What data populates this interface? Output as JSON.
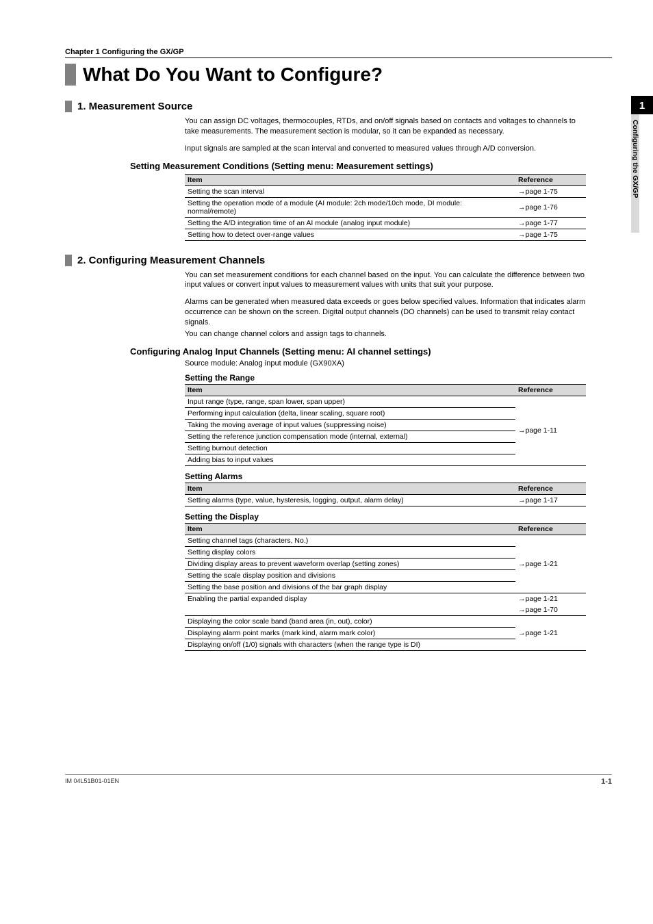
{
  "sideTab": {
    "num": "1",
    "label": "Configuring the GX/GP"
  },
  "chapterLine": "Chapter  1   Configuring the GX/GP",
  "pageTitle": "What Do You Want to Configure?",
  "section1": {
    "heading": "1. Measurement Source",
    "body1": "You can assign DC voltages, thermocouples, RTDs, and on/off signals based on contacts and voltages to channels to take measurements. The measurement section is modular, so it can be expanded as necessary.",
    "body2": "Input signals are sampled at the scan interval and converted to measured values through A/D conversion.",
    "sub1": {
      "heading": "Setting Measurement Conditions (Setting menu: Measurement settings)",
      "header_item": "Item",
      "header_ref": "Reference",
      "rows": [
        {
          "item": "Setting the scan interval",
          "ref": "→page 1-75"
        },
        {
          "item": "Setting the operation mode of a module (AI module: 2ch mode/10ch mode, DI module: normal/remote)",
          "ref": "→page 1-76"
        },
        {
          "item": "Setting the A/D integration time of an AI module (analog input module)",
          "ref": "→page 1-77"
        },
        {
          "item": "Setting how to detect over-range values",
          "ref": "→page 1-75"
        }
      ]
    }
  },
  "section2": {
    "heading": "2. Configuring Measurement Channels",
    "body1": "You can set measurement conditions for each channel based on the input. You can calculate the difference between two input values or convert input values to measurement values with units that suit your purpose.",
    "body2": "Alarms can be generated when measured data exceeds or goes below specified values. Information that indicates alarm occurrence can be shown on the screen. Digital output channels (DO channels) can be used to transmit relay contact signals.",
    "body3": "You can change channel colors and assign tags to channels.",
    "sub1": {
      "heading": "Configuring Analog Input Channels (Setting menu: AI channel settings)",
      "note": "Source module: Analog input module (GX90XA)",
      "group1": {
        "heading": "Setting the Range",
        "header_item": "Item",
        "header_ref": "Reference",
        "items": [
          "Input range (type, range, span lower, span upper)",
          "Performing input calculation (delta, linear scaling, square root)",
          "Taking the moving average of input values (suppressing noise)",
          "Setting the reference junction compensation mode (internal, external)",
          "Setting burnout detection",
          "Adding bias to input values"
        ],
        "ref": "→page 1-11"
      },
      "group2": {
        "heading": "Setting Alarms",
        "header_item": "Item",
        "header_ref": "Reference",
        "rows": [
          {
            "item": "Setting alarms (type, value, hysteresis, logging, output, alarm delay)",
            "ref": "→page 1-17"
          }
        ]
      },
      "group3": {
        "heading": "Setting the Display",
        "header_item": "Item",
        "header_ref": "Reference",
        "blockA_items": [
          "Setting channel tags (characters, No.)",
          "Setting display colors",
          "Dividing display areas to prevent waveform overlap (setting zones)",
          "Setting the scale display position and divisions",
          "Setting the base position and divisions of the bar graph display"
        ],
        "blockA_ref": "→page 1-21",
        "rowB": {
          "item": "Enabling the partial expanded display",
          "ref1": "→page 1-21",
          "ref2": "→page 1-70"
        },
        "blockC_items": [
          "Displaying the color scale band (band area (in, out), color)",
          "Displaying alarm point marks (mark kind, alarm mark color)",
          "Displaying on/off (1/0) signals with characters (when the range type is DI)"
        ],
        "blockC_ref": "→page 1-21"
      }
    }
  },
  "footer": {
    "left": "IM 04L51B01-01EN",
    "right": "1-1"
  }
}
